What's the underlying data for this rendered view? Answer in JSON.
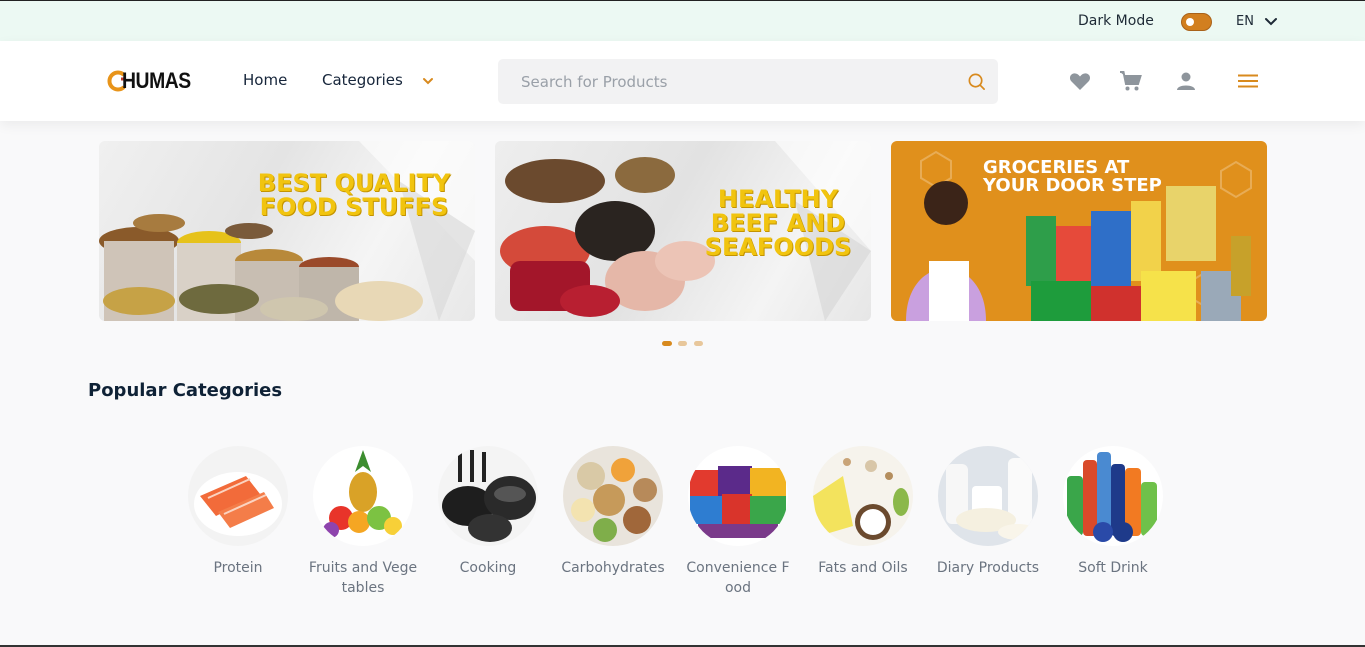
{
  "topbar": {
    "dark_mode_label": "Dark Mode",
    "dark_mode_on": false,
    "language": "EN"
  },
  "header": {
    "logo_text": "HUMAS",
    "nav": {
      "home": "Home",
      "categories": "Categories"
    },
    "search_placeholder": "Search for Products",
    "icons": [
      "heart-icon",
      "cart-icon",
      "user-icon",
      "menu-icon"
    ]
  },
  "banners": [
    {
      "title": "BEST QUALITY\nFOOD STUFFS"
    },
    {
      "title": "HEALTHY\nBEEF AND\nSEAFOODS"
    },
    {
      "title": "GROCERIES AT\nYOUR DOOR STEP"
    }
  ],
  "carousel": {
    "count": 3,
    "active_index": 0
  },
  "popular": {
    "title": "Popular Categories",
    "items": [
      {
        "label": "Protein"
      },
      {
        "label": "Fruits and Vegetables"
      },
      {
        "label": "Cooking"
      },
      {
        "label": "Carbohydrates"
      },
      {
        "label": "Convenience Food"
      },
      {
        "label": "Fats and Oils"
      },
      {
        "label": "Diary Products"
      },
      {
        "label": "Soft Drink"
      }
    ]
  },
  "colors": {
    "accent": "#d88a1e",
    "topbar_bg": "#ecf9f3",
    "banner_yellow": "#f1c40f",
    "heading": "#0f2236"
  }
}
